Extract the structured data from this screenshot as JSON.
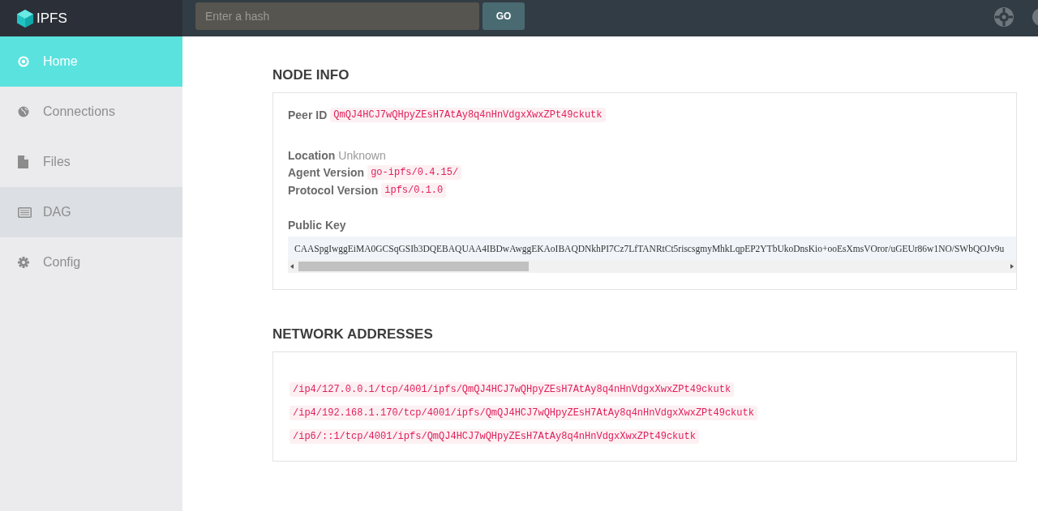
{
  "header": {
    "logo": "IPFS",
    "search": {
      "placeholder": "Enter a hash"
    },
    "go_button": "GO"
  },
  "sidebar": {
    "items": [
      {
        "label": "Home",
        "selected": true,
        "highlighted": false
      },
      {
        "label": "Connections",
        "selected": false,
        "highlighted": false
      },
      {
        "label": "Files",
        "selected": false,
        "highlighted": false
      },
      {
        "label": "DAG",
        "selected": false,
        "highlighted": true
      },
      {
        "label": "Config",
        "selected": false,
        "highlighted": false
      }
    ]
  },
  "node_info": {
    "title": "NODE INFO",
    "peer_id": {
      "label": "Peer ID",
      "value": "QmQJ4HCJ7wQHpyZEsH7AtAy8q4nHnVdgxXwxZPt49ckutk"
    },
    "location": {
      "label": "Location",
      "value": "Unknown"
    },
    "agent_version": {
      "label": "Agent Version",
      "value": "go-ipfs/0.4.15/"
    },
    "protocol_version": {
      "label": "Protocol Version",
      "value": "ipfs/0.1.0"
    },
    "public_key": {
      "label": "Public Key",
      "value": "CAASpgIwggEiMA0GCSqGSIb3DQEBAQUAA4IBDwAwggEKAoIBAQDNkhPI7Cz7LfTANRtCt5riscsgmyMhkLqpEP2YTbUkoDnsKio+ooEsXmsVOror/uGEUr86w1NO/SWbQOJv9u"
    }
  },
  "network_addresses": {
    "title": "NETWORK ADDRESSES",
    "addresses": [
      "/ip4/127.0.0.1/tcp/4001/ipfs/QmQJ4HCJ7wQHpyZEsH7AtAy8q4nHnVdgxXwxZPt49ckutk",
      "/ip4/192.168.1.170/tcp/4001/ipfs/QmQJ4HCJ7wQHpyZEsH7AtAy8q4nHnVdgxXwxZPt49ckutk",
      "/ip6/::1/tcp/4001/ipfs/QmQJ4HCJ7wQHpyZEsH7AtAy8q4nHnVdgxXwxZPt49ckutk"
    ]
  }
}
